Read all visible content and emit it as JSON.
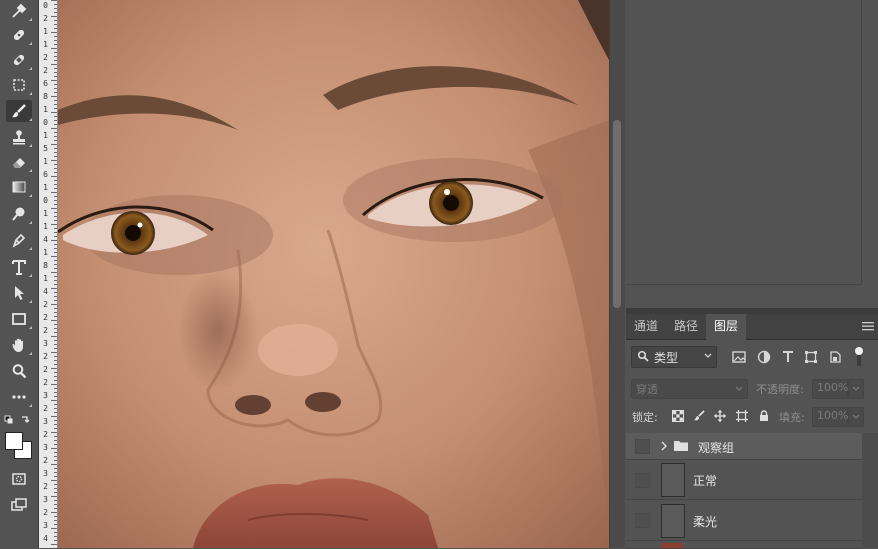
{
  "toolbar": {
    "tools": [
      {
        "icon": "eyedropper-icon"
      },
      {
        "icon": "spot-healing-brush-icon"
      },
      {
        "icon": "healing-brush-icon"
      },
      {
        "icon": "frame-icon"
      },
      {
        "icon": "brush-icon",
        "active": true
      },
      {
        "icon": "clone-stamp-icon"
      },
      {
        "icon": "eraser-icon"
      },
      {
        "icon": "gradient-icon"
      },
      {
        "icon": "dodge-icon"
      },
      {
        "icon": "pen-icon"
      },
      {
        "icon": "type-icon"
      },
      {
        "icon": "path-selection-icon"
      },
      {
        "icon": "rectangle-icon"
      },
      {
        "icon": "hand-icon"
      },
      {
        "icon": "zoom-icon"
      },
      {
        "icon": "more-tools-icon"
      }
    ],
    "foreground_color": "#ffffff",
    "background_color": "#ffffff"
  },
  "ruler": {
    "labels": [
      "0",
      "2",
      "1",
      "1",
      "2",
      "2",
      "6",
      "8",
      "1",
      "0",
      "1",
      "5",
      "1",
      "6",
      "1",
      "0",
      "1",
      "1",
      "4",
      "1",
      "8",
      "1",
      "4",
      "2",
      "2",
      "2",
      "3",
      "2",
      "2",
      "2",
      "3",
      "2",
      "3",
      "2",
      "3",
      "2",
      "3",
      "2",
      "3",
      "2",
      "3",
      "4"
    ]
  },
  "layers_panel": {
    "tabs": [
      {
        "label": "通道",
        "active": false
      },
      {
        "label": "路径",
        "active": false
      },
      {
        "label": "图层",
        "active": true
      }
    ],
    "filter_type": "类型",
    "blend_mode": "穿透",
    "opacity_label": "不透明度:",
    "opacity_value": "100%",
    "lock_label": "锁定:",
    "fill_label": "填充:",
    "fill_value": "100%",
    "layers": [
      {
        "name": "观察组",
        "kind": "group",
        "selected": true
      },
      {
        "name": "正常",
        "kind": "layer",
        "selected": false
      },
      {
        "name": "柔光",
        "kind": "layer",
        "selected": false
      }
    ]
  },
  "colors": {
    "app_bg": "#535353",
    "panel_dark": "#424242",
    "ruler_bg": "#e8e8e8",
    "selected_row": "#595959"
  }
}
